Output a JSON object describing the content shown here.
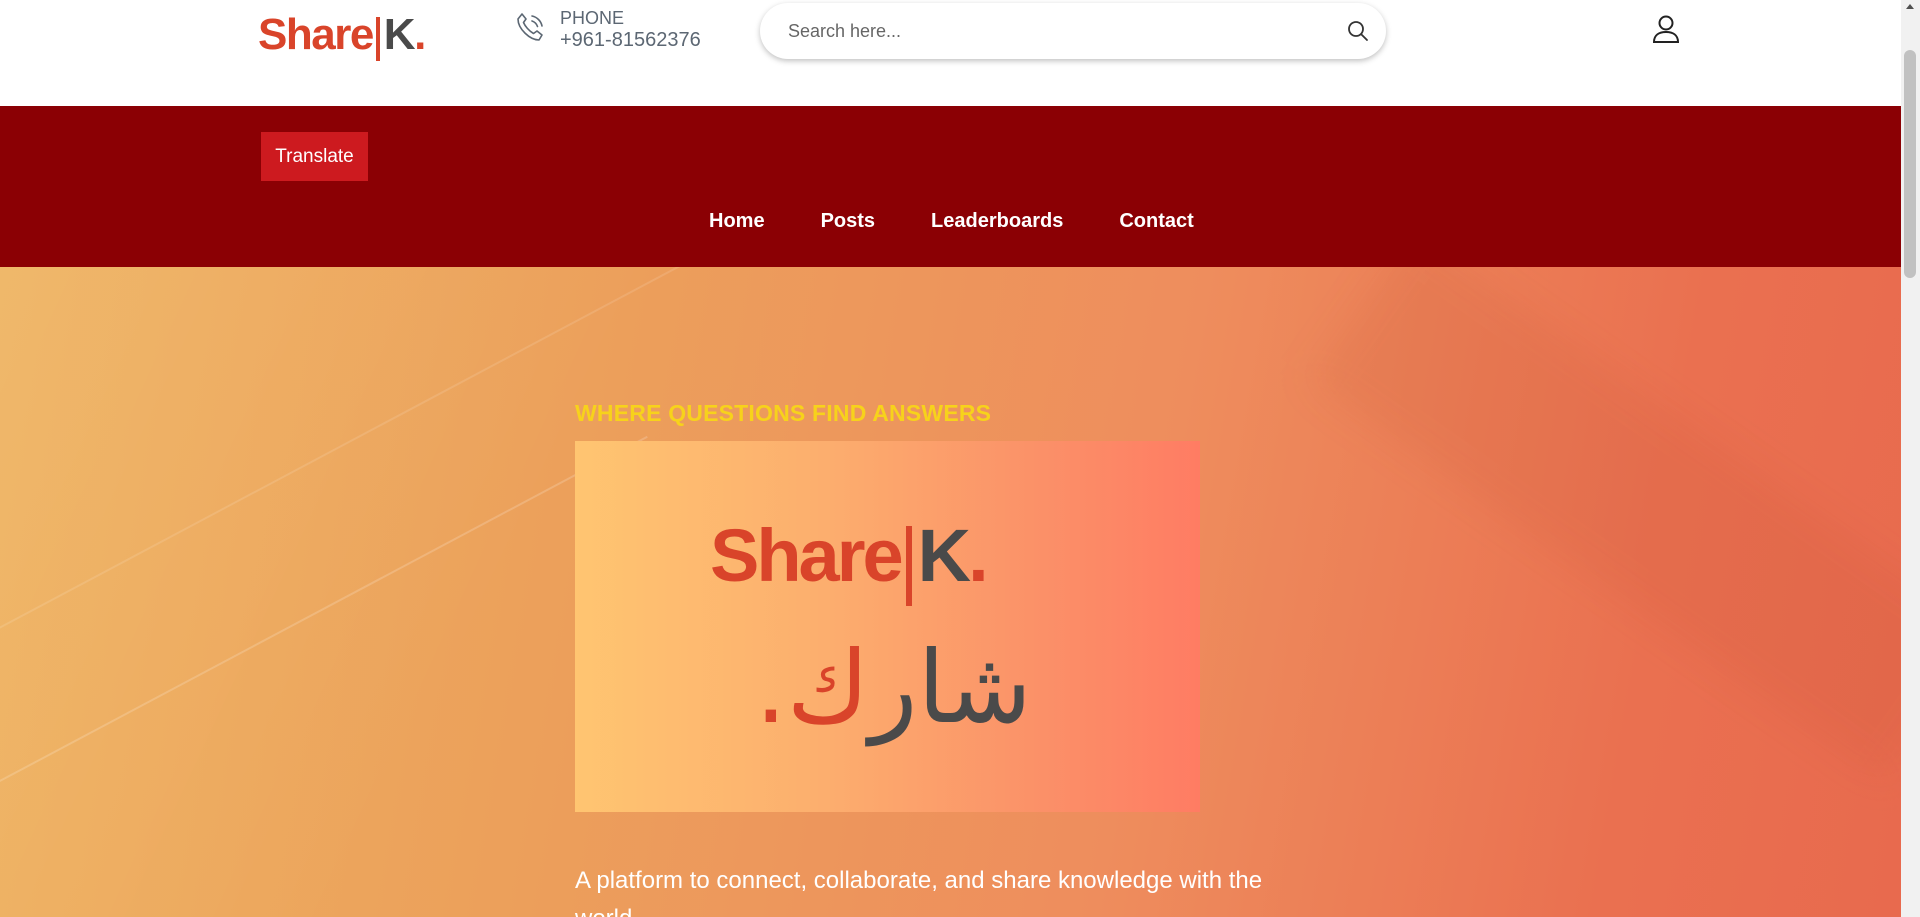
{
  "header": {
    "logo": {
      "share": "Share",
      "k": "K",
      "dot": "."
    },
    "phone": {
      "label": "PHONE",
      "number": "+961-81562376",
      "icon": "phone-icon"
    },
    "search": {
      "placeholder": "Search here...",
      "icon": "search-icon"
    },
    "account_icon": "user-icon"
  },
  "navband": {
    "translate_label": "Translate",
    "links": [
      "Home",
      "Posts",
      "Leaderboards",
      "Contact"
    ]
  },
  "hero": {
    "tagline": "WHERE QUESTIONS FIND ANSWERS",
    "image": {
      "logo": {
        "share": "Share",
        "k": "K",
        "dot": "."
      },
      "arabic_dot": ".",
      "arabic_k": "ك",
      "arabic_rest": "شار"
    },
    "description": "A platform to connect, collaborate, and share knowledge with the world."
  },
  "colors": {
    "brand_red": "#d9442a",
    "brand_gray": "#4a4a4a",
    "nav_bg": "#8b0004",
    "translate_bg": "#cd1a1f",
    "tagline": "#f7d21b"
  }
}
